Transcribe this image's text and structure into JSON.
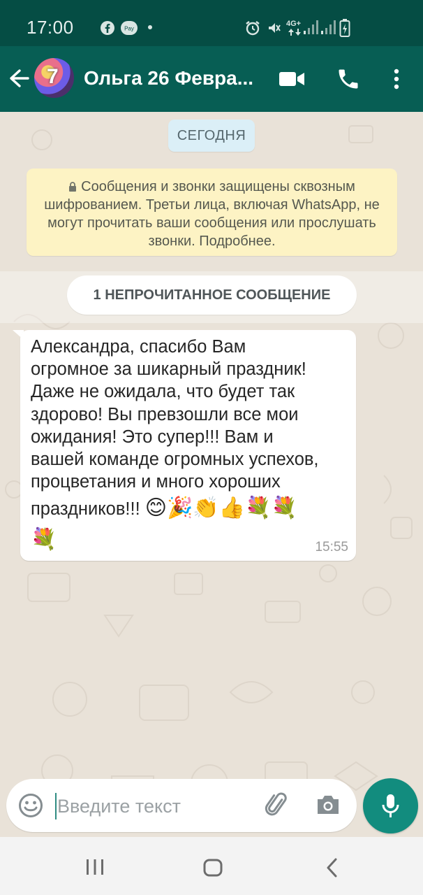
{
  "status_bar": {
    "time": "17:00",
    "network_label": "4G+"
  },
  "header": {
    "title": "Ольга 26 Февра...",
    "avatar_label": "7"
  },
  "chat": {
    "date_label": "СЕГОДНЯ",
    "encryption_notice": "Сообщения и звонки защищены сквозным шифрованием. Третьи лица, включая WhatsApp, не могут прочитать ваши сообщения или прослушать звонки. Подробнее.",
    "unread_label": "1 НЕПРОЧИТАННОЕ СООБЩЕНИЕ",
    "messages": [
      {
        "lines": [
          "Александра, спасибо Вам",
          "огромное за шикарный праздник!",
          "Даже не ожидала, что будет так",
          "здорово! Вы превзошли все мои",
          "ожидания! Это супер!!! Вам и",
          "вашей команде огромных успехов,",
          "процветания и много хороших",
          "праздников!!!"
        ],
        "emojis": "😊🎉👏👍💐💐",
        "emojis_line2": "💐",
        "time": "15:55"
      }
    ]
  },
  "composer": {
    "placeholder": "Введите текст"
  },
  "colors": {
    "header": "#075e54",
    "status": "#054d44",
    "accent": "#128c7e"
  },
  "icons": [
    "back-arrow-icon",
    "video-call-icon",
    "phone-icon",
    "more-vert-icon",
    "emoji-icon",
    "attach-icon",
    "camera-icon",
    "mic-icon",
    "lock-icon"
  ]
}
